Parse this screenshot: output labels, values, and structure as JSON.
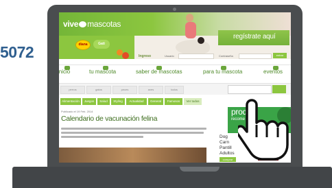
{
  "side_number": "5072",
  "site": {
    "logo_bold": "vive",
    "logo_thin": "mascotas",
    "brand_a": "diana",
    "brand_b": "Gati",
    "register_text": "regístrate aquí",
    "login": {
      "title": "Ingreso",
      "user_label": "Usuario",
      "pass_label": "Contraseña",
      "submit": "entrar"
    }
  },
  "nav": {
    "items": [
      {
        "label": "inicio",
        "icon": "home-icon"
      },
      {
        "label": "tu mascota",
        "icon": "paw-icon"
      },
      {
        "label": "saber de mascotas",
        "icon": "lightbulb-icon"
      },
      {
        "label": "para tu mascota",
        "icon": "gift-icon"
      },
      {
        "label": "eventos",
        "icon": "calendar-icon"
      }
    ]
  },
  "filters": {
    "tags": [
      "perros",
      "gatos",
      "peces",
      "aves",
      "todos"
    ]
  },
  "categories": [
    "Alimentación",
    "Juegos",
    "Salud",
    "Styling",
    "Actualidad",
    "General",
    "Famosos",
    "Ver todos"
  ],
  "article": {
    "dateline": "Publicado el 19 Feb. 2014",
    "title": "Calendario de vacunación felina"
  },
  "promo": {
    "big": "prod",
    "small": "recome",
    "product_lines": [
      "Dog",
      "Carn",
      "Pantill",
      "Adultos"
    ],
    "buy_label": "comprar"
  },
  "colors": {
    "brand_green": "#8cc63f",
    "title_green": "#3d6d1d",
    "laptop": "#4a4d4f",
    "side_number": "#2f5f8f"
  }
}
